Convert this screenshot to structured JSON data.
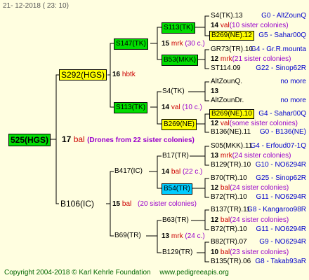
{
  "header": {
    "date": "21- 12-2018 (  23:  10)"
  },
  "footer": {
    "copyright": "Copyright 2004-2018 © Karl Kehrle Foundation",
    "site": "www.pedigreeapis.org"
  },
  "root": {
    "id": "525(HGS)",
    "num": "17",
    "ab": "bal",
    "note": "(Drones from 22 sister colonies)"
  },
  "mother": {
    "id": "S292(HGS)",
    "num": "16",
    "ab": "hbtk"
  },
  "father": {
    "id": "B106(IC)",
    "num": "15",
    "ab": "bal",
    "note": "(20 sister colonies)"
  },
  "g3": {
    "a": {
      "id": "S147(TK)",
      "num": "15",
      "ab": "mrk",
      "note": "(30 c.)"
    },
    "b": {
      "id": "S113(TK)",
      "num": "14",
      "ab": "val",
      "note": "(10 c.)"
    },
    "c": {
      "id": "B417(IC)",
      "num": "14",
      "ab": "bal",
      "note": "(22 c.)"
    },
    "d": {
      "id": "B69(TR)",
      "num": "13",
      "ab": "mrk",
      "note": "(24 c.)"
    }
  },
  "g4": {
    "a": {
      "id": "S113(TK)"
    },
    "b": {
      "id": "B53(MKK)"
    },
    "c": {
      "id": "S4(TK)"
    },
    "d": {
      "id": "B269(NE)"
    },
    "e": {
      "id": "B17(TR)"
    },
    "f": {
      "id": "B54(TR)"
    },
    "g": {
      "id": "B63(TR)"
    },
    "h": {
      "id": "B129(TR)"
    }
  },
  "g5": {
    "a": {
      "top": "S4(TK).13",
      "top_r": "G0 - AltZounQ",
      "num": "14",
      "ab": "val",
      "note": "(10 sister colonies)",
      "bot": "B269(NE).12",
      "bot_r": "G5 - Sahar00Q"
    },
    "b": {
      "top": "GR73(TR).10",
      "top_r": "G4 - Gr.R.mounta",
      "num": "12",
      "ab": "mrk",
      "note": "(21 sister colonies)",
      "bot": "ST114.09",
      "bot_r": "G22 - Sinop62R"
    },
    "c": {
      "top": "AltZounQ.",
      "top_r": "no more",
      "num": "13",
      "ab": "",
      "note": "",
      "bot": "AltZounDr.",
      "bot_r": "no more"
    },
    "d": {
      "top": "B269(NE).10",
      "top_r": "G4 - Sahar00Q",
      "num": "12",
      "ab": "val",
      "note": "(some sister colonies)",
      "bot": "B136(NE).11",
      "bot_r": "G0 - B136(NE)"
    },
    "e": {
      "top": "S05(MKK).11",
      "top_r": "G4 - Erfoud07-1Q",
      "num": "13",
      "ab": "mrk",
      "note": "(24 sister colonies)",
      "bot": "B129(TR).10",
      "bot_r": "G10 - NO6294R"
    },
    "f": {
      "top": "B70(TR).10",
      "top_r": "G25 - Sinop62R",
      "num": "12",
      "ab": "bal",
      "note": "(24 sister colonies)",
      "bot": "B72(TR).10",
      "bot_r": "G11 - NO6294R"
    },
    "g": {
      "top": "B137(TR).11",
      "top_r": "G8 - Kangaroo98R",
      "num": "12",
      "ab": "bal",
      "note": "(24 sister colonies)",
      "bot": "B72(TR).10",
      "bot_r": "G11 - NO6294R"
    },
    "h": {
      "top": "B82(TR).07",
      "top_r": "G9 - NO6294R",
      "num": "10",
      "ab": "bal",
      "note": "(23 sister colonies)",
      "bot": "B135(TR).06",
      "bot_r": "G8 - Takab93aR"
    }
  }
}
